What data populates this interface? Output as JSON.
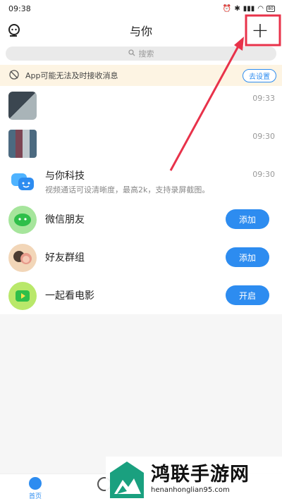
{
  "status_bar": {
    "time": "09:38",
    "battery": "80"
  },
  "header": {
    "title": "与你",
    "add_symbol": "+"
  },
  "search": {
    "placeholder": "搜索"
  },
  "notice": {
    "text": "App可能无法及时接收消息",
    "action": "去设置"
  },
  "chats": [
    {
      "name": "",
      "time": "09:33"
    },
    {
      "name": "",
      "time": "09:30"
    },
    {
      "name": "与你科技",
      "preview": "视频通话可设清晰度，最高2k，支持录屏截图。",
      "time": "09:30"
    }
  ],
  "features": [
    {
      "name": "微信朋友",
      "action": "添加"
    },
    {
      "name": "好友群组",
      "action": "添加"
    },
    {
      "name": "一起看电影",
      "action": "开启"
    }
  ],
  "bottom_nav": {
    "home_label": "首页"
  },
  "watermark": {
    "title": "鸿联手游网",
    "url": "henanhonglian95.com"
  },
  "colors": {
    "accent": "#2d8cf0",
    "annotation": "#e8324a"
  }
}
